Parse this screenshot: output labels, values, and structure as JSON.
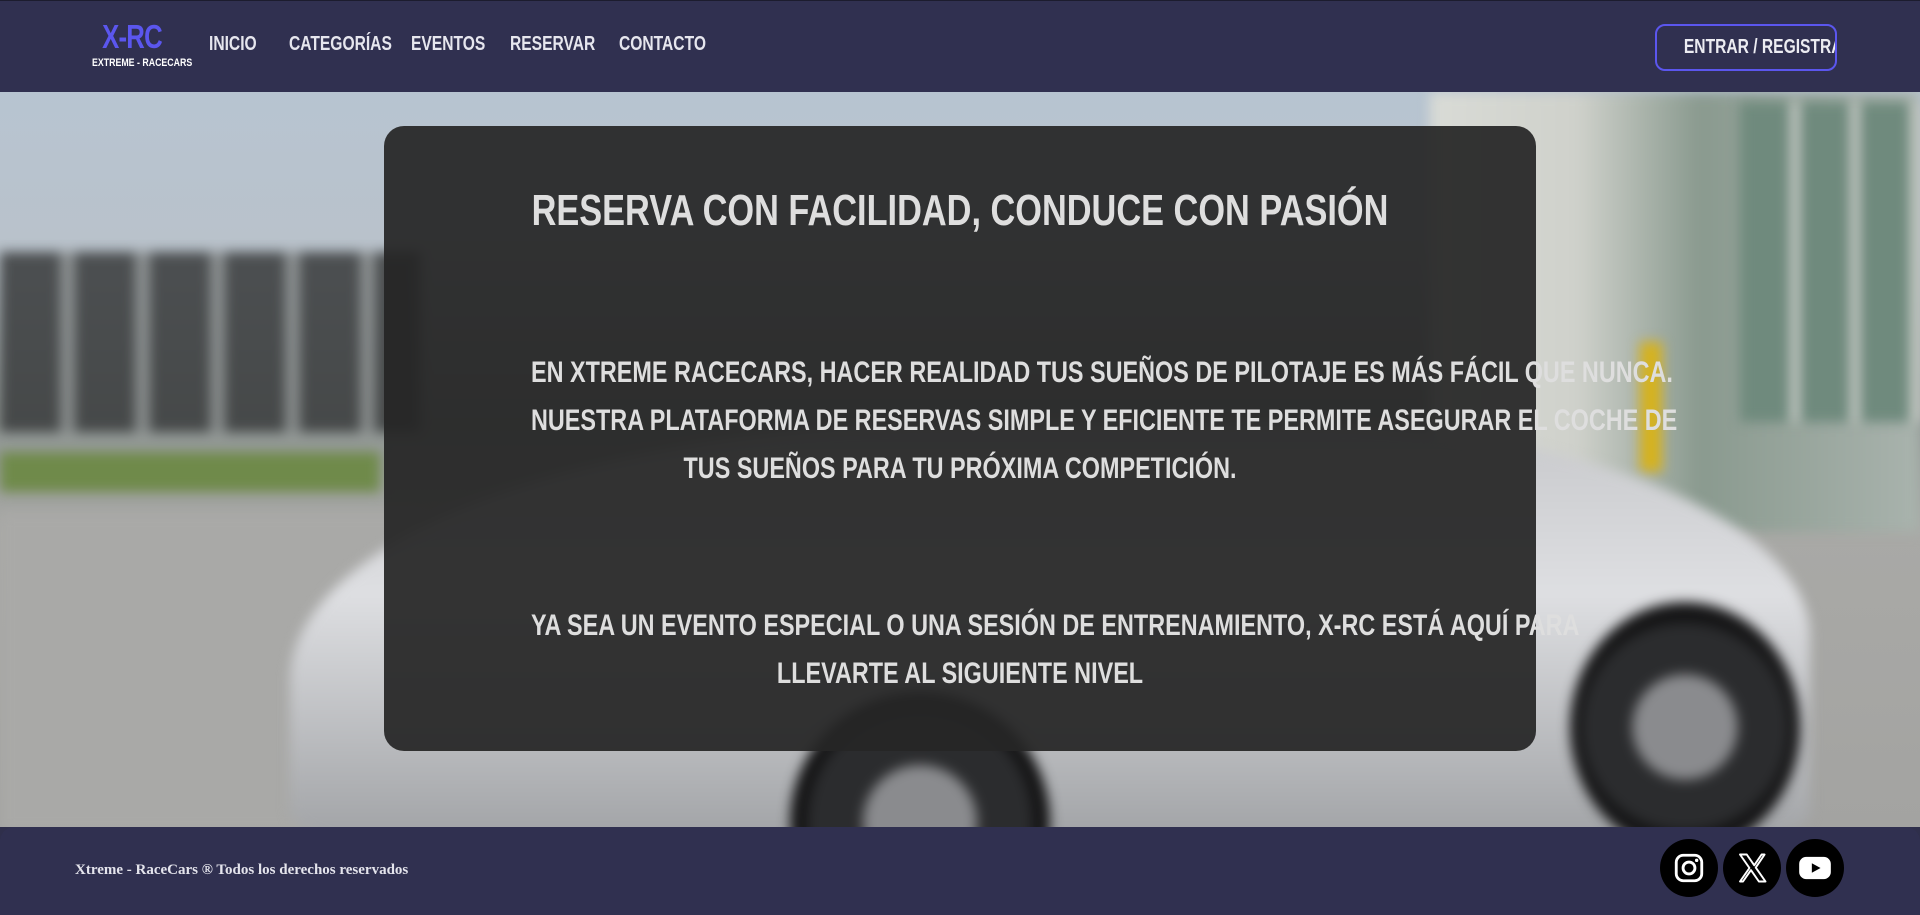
{
  "brand": {
    "logo": "X-RC",
    "tagline": "EXTREME - RACECARS"
  },
  "nav": {
    "items": [
      {
        "label": "INICIO"
      },
      {
        "label": "CATEGORÍAS"
      },
      {
        "label": "EVENTOS"
      },
      {
        "label": "RESERVAR"
      },
      {
        "label": "CONTACTO"
      }
    ],
    "login_label": "ENTRAR / REGISTRARSE"
  },
  "hero": {
    "title": "RESERVA CON FACILIDAD, CONDUCE CON PASIÓN",
    "paragraph1": [
      "EN XTREME RACECARS, HACER REALIDAD TUS SUEÑOS DE PILOTAJE ES MÁS FÁCIL QUE NUNCA.",
      "NUESTRA PLATAFORMA DE RESERVAS SIMPLE Y EFICIENTE TE PERMITE ASEGURAR EL COCHE DE",
      "TUS SUEÑOS PARA TU PRÓXIMA COMPETICIÓN."
    ],
    "paragraph2": [
      "YA SEA UN EVENTO ESPECIAL O UNA SESIÓN DE ENTRENAMIENTO, X-RC ESTÁ AQUÍ PARA",
      "LLEVARTE AL SIGUIENTE NIVEL"
    ]
  },
  "footer": {
    "copyright": "Xtreme - RaceCars ® Todos los derechos reservados",
    "social": [
      {
        "icon": "instagram-icon"
      },
      {
        "icon": "x-twitter-icon"
      },
      {
        "icon": "youtube-icon"
      }
    ]
  },
  "colors": {
    "accent": "#5b56ee",
    "navbar_bg": "#303050",
    "card_bg": "#262626"
  }
}
